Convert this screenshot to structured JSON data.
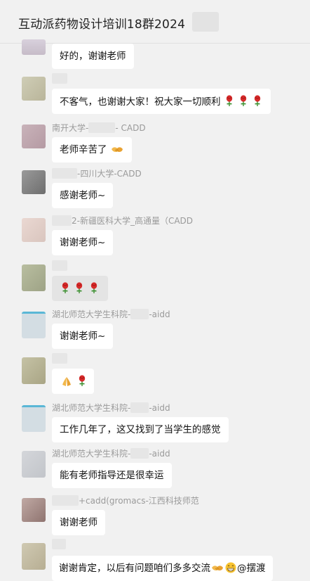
{
  "chat": {
    "title": "互动派药物设计培训18群2024"
  },
  "messages": [
    {
      "sender": "",
      "text": "好的，谢谢老师"
    },
    {
      "sender": "",
      "text": "不客气，也谢谢大家！祝大家一切顺利"
    },
    {
      "sender_a": "南开大学-",
      "sender_b": "- CADD",
      "text": "老师辛苦了"
    },
    {
      "sender_b": "-四川大学-CADD",
      "text": "感谢老师~"
    },
    {
      "sender_b": "2-新疆医科大学_高通量（CADD",
      "text": "谢谢老师~"
    },
    {
      "sender": "",
      "text": ""
    },
    {
      "sender_a": "湖北师范大学生科院-",
      "sender_b": "-aidd",
      "text": "谢谢老师~"
    },
    {
      "sender": "",
      "text": ""
    },
    {
      "sender_a": "湖北师范大学生科院-",
      "sender_b": "-aidd",
      "text": "工作几年了，这又找到了当学生的感觉"
    },
    {
      "sender_a": "湖北师范大学生科院-",
      "sender_b": "-aidd",
      "text": "能有老师指导还是很幸运"
    },
    {
      "sender_b": "+cadd(gromacs-江西科技师范",
      "text": "谢谢老师"
    },
    {
      "sender": "",
      "text": "谢谢肯定，以后有问题咱们多多交流",
      "mention": "@摆渡"
    }
  ],
  "icons": {
    "rose": "rose-emoji-icon",
    "handshake": "handshake-emoji-icon",
    "pray": "folded-hands-emoji-icon",
    "grin": "grinning-emoji-icon"
  }
}
